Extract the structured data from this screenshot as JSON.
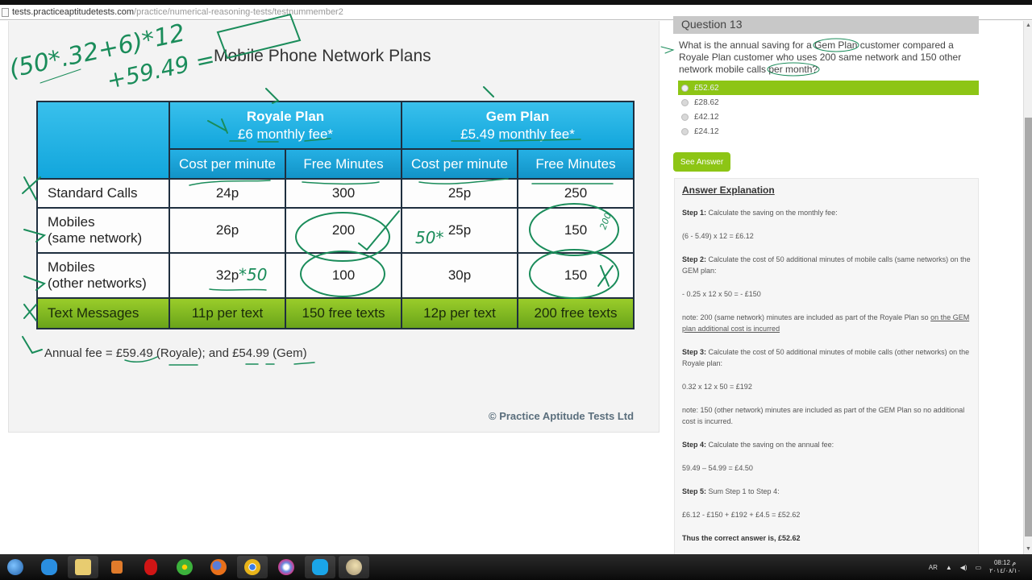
{
  "browser": {
    "url_host": "tests.practiceaptitudetests.com",
    "url_path": "/practice/numerical-reasoning-tests/testnummember2"
  },
  "chart": {
    "title": "Mobile Phone Network Plans",
    "plans": [
      {
        "name": "Royale Plan",
        "fee": "£6 monthly fee*"
      },
      {
        "name": "Gem Plan",
        "fee": "£5.49 monthly fee*"
      }
    ],
    "subheaders": [
      "Cost per minute",
      "Free Minutes",
      "Cost per minute",
      "Free Minutes"
    ],
    "rows": [
      {
        "label": "Standard Calls",
        "cells": [
          "24p",
          "300",
          "25p",
          "250"
        ]
      },
      {
        "label": "Mobiles\n(same network)",
        "label_line1": "Mobiles",
        "label_line2": "(same network)",
        "cells": [
          "26p",
          "200",
          "25p",
          "150"
        ]
      },
      {
        "label_line1": "Mobiles",
        "label_line2": "(other networks)",
        "cells": [
          "32p",
          "100",
          "30p",
          "150"
        ]
      },
      {
        "label": "Text Messages",
        "cells": [
          "11p per text",
          "150 free texts",
          "12p per text",
          "200 free texts"
        ]
      }
    ],
    "annual_fee_note": "Annual fee = £59.49 (Royale); and £54.99 (Gem)",
    "copyright": "© Practice Aptitude Tests Ltd"
  },
  "chart_data": {
    "type": "table",
    "title": "Mobile Phone Network Plans",
    "columns": [
      "",
      "Royale Plan – Cost per minute",
      "Royale Plan – Free Minutes",
      "Gem Plan – Cost per minute",
      "Gem Plan – Free Minutes"
    ],
    "column_groups": [
      {
        "name": "Royale Plan",
        "fee": "£6 monthly fee*"
      },
      {
        "name": "Gem Plan",
        "fee": "£5.49 monthly fee*"
      }
    ],
    "rows": [
      [
        "Standard Calls",
        "24p",
        "300",
        "25p",
        "250"
      ],
      [
        "Mobiles (same network)",
        "26p",
        "200",
        "25p",
        "150"
      ],
      [
        "Mobiles (other networks)",
        "32p",
        "100",
        "30p",
        "150"
      ],
      [
        "Text Messages",
        "11p per text",
        "150 free texts",
        "12p per text",
        "200 free texts"
      ]
    ],
    "footnote": "Annual fee = £59.49 (Royale); and £54.99 (Gem)"
  },
  "question": {
    "header": "Question 13",
    "text": "What is the annual saving for a Gem Plan customer compared a Royale Plan customer who uses 200 same network and 150 other network mobile calls per month?",
    "options": [
      {
        "label": "£52.62",
        "selected": true
      },
      {
        "label": "£28.62",
        "selected": false
      },
      {
        "label": "£42.12",
        "selected": false
      },
      {
        "label": "£24.12",
        "selected": false
      }
    ],
    "see_answer_label": "See Answer"
  },
  "explanation": {
    "title": "Answer Explanation",
    "step1_label": "Step 1:",
    "step1_text": " Calculate the saving on the monthly fee:",
    "step1_calc": "(6 - 5.49) x 12 = £6.12",
    "step2_label": "Step 2:",
    "step2_text": " Calculate the cost of 50 additional minutes of mobile calls (same networks) on the GEM plan:",
    "step2_calc": "- 0.25 x 12 x 50 = - £150",
    "note1_text": "note:  200 (same network) minutes are included as part of the Royale Plan so ",
    "note1_underlined": "on the GEM plan additional cost is incurred",
    "step3_label": "Step 3:",
    "step3_text": " Calculate the cost of 50 additional minutes of mobile calls (other networks) on the Royale plan:",
    "step3_calc": "0.32 x 12 x 50 = £192",
    "note2_text": "note:  150 (other network) minutes are included as part of the GEM Plan so no additional cost is incurred.",
    "step4_label": "Step 4:",
    "step4_text": " Calculate the saving on the annual fee:",
    "step4_calc": "59.49 – 54.99 = £4.50",
    "step5_label": "Step 5:",
    "step5_text": " Sum Step 1 to Step 4:",
    "step5_calc": "£6.12 - £150 + £192 + £4.5 = £52.62",
    "conclusion": "Thus the correct answer is, £52.62"
  },
  "annotations": {
    "formula_line1": "(50*.32+6)*12",
    "formula_line2": "+59.49 =",
    "note_50_same": "50*",
    "note_50_other": "*50",
    "note_200": "200"
  },
  "taskbar": {
    "apps": [
      "start",
      "internet-explorer",
      "file-explorer",
      "media-player",
      "opera",
      "icq",
      "firefox",
      "chrome",
      "app-swirl",
      "skype",
      "paint"
    ],
    "tray": {
      "language": "AR",
      "time": "08:12 م",
      "date": "٢٠١٤/٠٨/١٠"
    }
  },
  "colors": {
    "header_blue": "#1aabe0",
    "row_green": "#7fb820",
    "selected_green": "#8dc515",
    "ink_green": "#1a8c5a"
  }
}
